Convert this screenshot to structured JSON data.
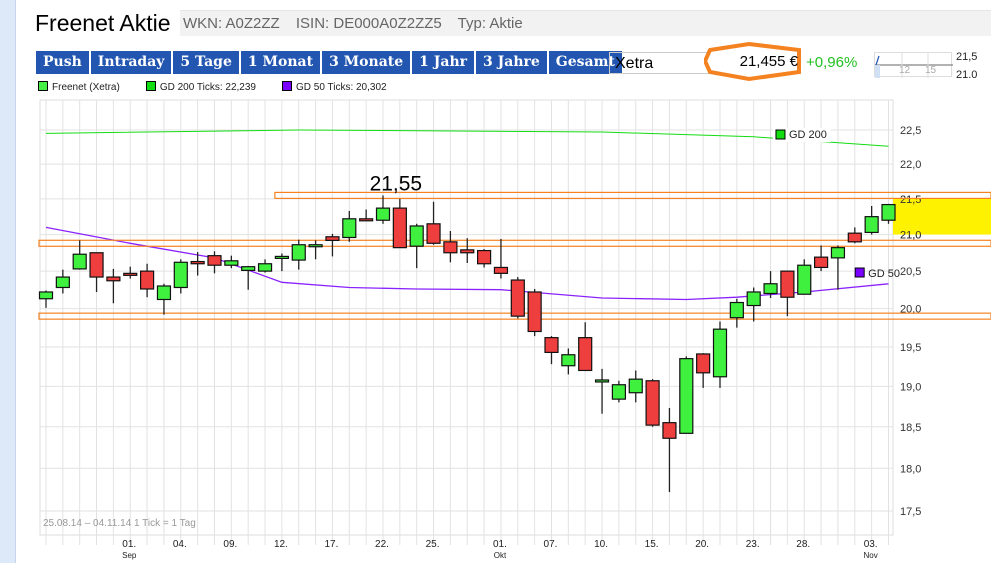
{
  "header": {
    "title": "Freenet Aktie",
    "wkn": "WKN: A0Z2ZZ",
    "isin": "ISIN: DE000A0Z2ZZ5",
    "typ": "Typ: Aktie"
  },
  "tabs": [
    "Push",
    "Intraday",
    "5 Tage",
    "1 Monat",
    "3 Monate",
    "1 Jahr",
    "3 Jahre",
    "Gesamt"
  ],
  "exchange": {
    "selected": "Xetra"
  },
  "quote": {
    "price": "21,455 €",
    "change": "+0,96%",
    "change_color": "#22c022",
    "highlight_color": "#f58220"
  },
  "mini_chart": {
    "x_labels": [
      "12",
      "15"
    ],
    "y_labels": [
      "21,5",
      "21.0"
    ]
  },
  "legend": [
    {
      "label": "Freenet (Xetra)",
      "color": "#44ee44"
    },
    {
      "label": "GD 200 Ticks: 22,239",
      "color": "#11dd11"
    },
    {
      "label": "GD 50 Ticks: 20,302",
      "color": "#7a00ff"
    }
  ],
  "chart_data": {
    "type": "candlestick",
    "range_label": "25.08.14 – 04.11.14   1 Tick = 1 Tag",
    "ylim": [
      17.5,
      22.5
    ],
    "y_scale": "log",
    "y_ticks": [
      "22,5",
      "22,0",
      "21,5",
      "21,0",
      "20,5",
      "20,0",
      "19,5",
      "19,0",
      "18,5",
      "18,0",
      "17,5"
    ],
    "y_tick_values": [
      22.5,
      22.0,
      21.5,
      21.0,
      20.5,
      20.0,
      19.5,
      19.0,
      18.5,
      18.0,
      17.5
    ],
    "x_ticks": [
      {
        "i": 5,
        "label": "01.",
        "month": "Sep"
      },
      {
        "i": 8,
        "label": "04."
      },
      {
        "i": 11,
        "label": "09."
      },
      {
        "i": 14,
        "label": "12."
      },
      {
        "i": 17,
        "label": "17."
      },
      {
        "i": 20,
        "label": "22."
      },
      {
        "i": 23,
        "label": "25."
      },
      {
        "i": 27,
        "label": "01.",
        "month": "Okt"
      },
      {
        "i": 30,
        "label": "07."
      },
      {
        "i": 33,
        "label": "10."
      },
      {
        "i": 36,
        "label": "15."
      },
      {
        "i": 39,
        "label": "20."
      },
      {
        "i": 42,
        "label": "23."
      },
      {
        "i": 45,
        "label": "28."
      },
      {
        "i": 49,
        "label": "03.",
        "month": "Nov"
      }
    ],
    "ohlc": [
      [
        20.13,
        20.24,
        20.01,
        20.22
      ],
      [
        20.28,
        20.52,
        20.2,
        20.42
      ],
      [
        20.53,
        20.92,
        20.52,
        20.73
      ],
      [
        20.75,
        20.75,
        20.22,
        20.42
      ],
      [
        20.42,
        20.53,
        20.07,
        20.37
      ],
      [
        20.47,
        20.56,
        20.4,
        20.46
      ],
      [
        20.5,
        20.6,
        20.15,
        20.26
      ],
      [
        20.12,
        20.33,
        19.92,
        20.3
      ],
      [
        20.28,
        20.66,
        20.2,
        20.62
      ],
      [
        20.63,
        20.76,
        20.44,
        20.6
      ],
      [
        20.71,
        20.77,
        20.47,
        20.58
      ],
      [
        20.58,
        20.71,
        20.54,
        20.64
      ],
      [
        20.51,
        20.57,
        20.25,
        20.56
      ],
      [
        20.5,
        20.66,
        20.48,
        20.6
      ],
      [
        20.69,
        20.74,
        20.5,
        20.7
      ],
      [
        20.65,
        20.93,
        20.52,
        20.86
      ],
      [
        20.85,
        20.92,
        20.66,
        20.86
      ],
      [
        20.97,
        21.01,
        20.7,
        20.92
      ],
      [
        20.96,
        21.33,
        20.9,
        21.22
      ],
      [
        21.22,
        21.35,
        21.19,
        21.2
      ],
      [
        21.2,
        21.55,
        21.15,
        21.37
      ],
      [
        21.37,
        21.5,
        20.82,
        20.82
      ],
      [
        20.84,
        21.15,
        20.54,
        21.12
      ],
      [
        21.15,
        21.46,
        20.86,
        20.88
      ],
      [
        20.9,
        21.05,
        20.62,
        20.75
      ],
      [
        20.79,
        20.95,
        20.61,
        20.75
      ],
      [
        20.78,
        20.8,
        20.55,
        20.6
      ],
      [
        20.55,
        20.94,
        20.4,
        20.47
      ],
      [
        20.38,
        20.42,
        19.87,
        19.9
      ],
      [
        20.22,
        20.26,
        19.64,
        19.7
      ],
      [
        19.62,
        19.64,
        19.28,
        19.43
      ],
      [
        19.26,
        19.48,
        19.15,
        19.4
      ],
      [
        19.62,
        19.82,
        19.2,
        19.2
      ],
      [
        19.06,
        19.22,
        18.66,
        19.08
      ],
      [
        18.84,
        19.07,
        18.8,
        19.02
      ],
      [
        18.92,
        19.2,
        18.8,
        19.09
      ],
      [
        19.07,
        19.09,
        18.5,
        18.52
      ],
      [
        18.55,
        18.73,
        17.72,
        18.36
      ],
      [
        18.42,
        19.38,
        18.42,
        19.35
      ],
      [
        19.41,
        19.42,
        18.98,
        19.17
      ],
      [
        19.12,
        19.83,
        18.98,
        19.73
      ],
      [
        19.88,
        20.13,
        19.75,
        20.08
      ],
      [
        20.04,
        20.28,
        19.83,
        20.22
      ],
      [
        20.2,
        20.5,
        20.14,
        20.33
      ],
      [
        20.5,
        20.5,
        19.9,
        20.15
      ],
      [
        20.19,
        20.66,
        20.19,
        20.58
      ],
      [
        20.69,
        20.85,
        20.5,
        20.55
      ],
      [
        20.68,
        20.85,
        20.25,
        20.82
      ],
      [
        21.02,
        21.1,
        20.88,
        20.9
      ],
      [
        21.03,
        21.4,
        21.0,
        21.25
      ],
      [
        21.2,
        21.43,
        21.15,
        21.42
      ]
    ],
    "gd200": {
      "label": "GD 200 Ticks",
      "short_label": "GD 200",
      "points": [
        [
          0,
          22.45
        ],
        [
          15,
          22.5
        ],
        [
          33,
          22.47
        ],
        [
          42,
          22.4
        ],
        [
          50,
          22.26
        ]
      ]
    },
    "gd50": {
      "label": "GD 50 Ticks",
      "short_label": "GD 50",
      "points": [
        [
          0,
          21.1
        ],
        [
          5,
          20.88
        ],
        [
          10,
          20.68
        ],
        [
          14,
          20.35
        ],
        [
          18,
          20.28
        ],
        [
          22,
          20.26
        ],
        [
          27,
          20.25
        ],
        [
          33,
          20.14
        ],
        [
          38,
          20.12
        ],
        [
          41,
          20.15
        ],
        [
          45,
          20.22
        ],
        [
          50,
          20.33
        ]
      ]
    },
    "annotation": {
      "text": "21,55",
      "index": 21,
      "value": 21.55
    },
    "levels": [
      {
        "value": 21.55,
        "from_index": 14
      },
      {
        "value": 20.88,
        "from_index": 0
      },
      {
        "value": 19.9,
        "from_index": 0
      }
    ],
    "highlight_band": [
      21.0,
      21.5
    ]
  }
}
